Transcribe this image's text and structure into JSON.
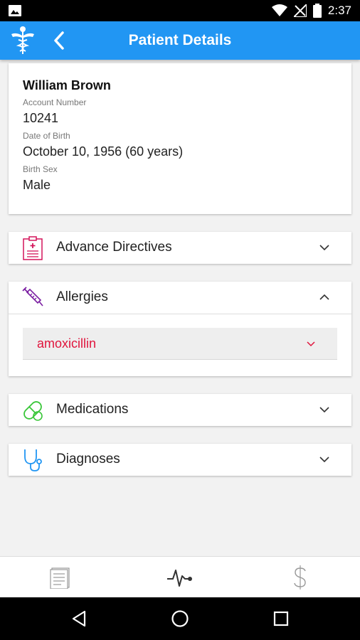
{
  "status_bar": {
    "time": "2:37",
    "icons": [
      "gallery-icon",
      "wifi-icon",
      "signal-off-icon",
      "battery-icon"
    ]
  },
  "app_bar": {
    "title": "Patient Details",
    "logo": "caduceus-icon",
    "back": "chevron-left-icon"
  },
  "patient": {
    "name": "William Brown",
    "account_label": "Account Number",
    "account_value": "10241",
    "dob_label": "Date of Birth",
    "dob_value": "October 10, 1956 (60 years)",
    "sex_label": "Birth Sex",
    "sex_value": "Male"
  },
  "sections": {
    "advance_directives": {
      "label": "Advance Directives",
      "icon": "clipboard-medical-icon",
      "color": "#d4145a",
      "expanded": false
    },
    "allergies": {
      "label": "Allergies",
      "icon": "syringe-icon",
      "color": "#7b1fa2",
      "expanded": true,
      "items": [
        {
          "name": "amoxicillin",
          "color": "#e0143c"
        }
      ]
    },
    "medications": {
      "label": "Medications",
      "icon": "pill-icon",
      "color": "#39c639",
      "expanded": false
    },
    "diagnoses": {
      "label": "Diagnoses",
      "icon": "stethoscope-icon",
      "color": "#2196f3",
      "expanded": false
    }
  },
  "bottom_nav": {
    "tabs": [
      {
        "icon": "document-icon",
        "active": false
      },
      {
        "icon": "heartbeat-icon",
        "active": true
      },
      {
        "icon": "dollar-icon",
        "active": false
      }
    ]
  },
  "system_nav": [
    "back-triangle-icon",
    "home-circle-icon",
    "recents-square-icon"
  ],
  "colors": {
    "primary": "#2196f3",
    "allergy_text": "#e0143c",
    "background": "#f2f2f2"
  }
}
